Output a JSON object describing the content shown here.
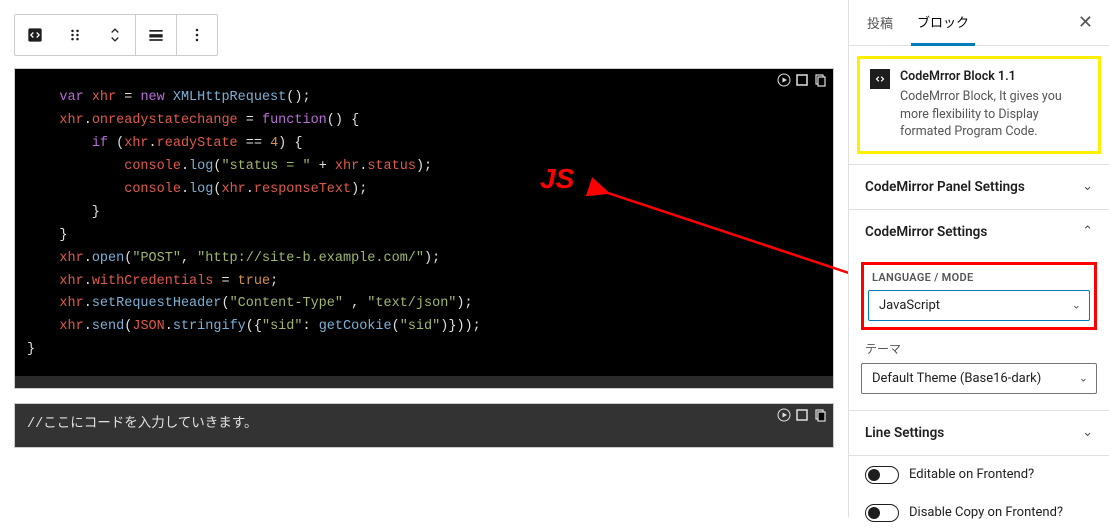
{
  "annotation": {
    "js_label": "JS"
  },
  "code1": {
    "lines": [
      [
        {
          "c": "kw",
          "t": "    var "
        },
        {
          "c": "var",
          "t": "xhr"
        },
        {
          "c": "op",
          "t": " = "
        },
        {
          "c": "kw",
          "t": "new "
        },
        {
          "c": "fn",
          "t": "XMLHttpRequest"
        },
        {
          "c": "op",
          "t": "();"
        }
      ],
      [
        {
          "c": "op",
          "t": "    "
        },
        {
          "c": "var",
          "t": "xhr"
        },
        {
          "c": "op",
          "t": "."
        },
        {
          "c": "var",
          "t": "onreadystatechange"
        },
        {
          "c": "op",
          "t": " = "
        },
        {
          "c": "kw",
          "t": "function"
        },
        {
          "c": "op",
          "t": "() {"
        }
      ],
      [
        {
          "c": "op",
          "t": "        "
        },
        {
          "c": "kw",
          "t": "if"
        },
        {
          "c": "op",
          "t": " ("
        },
        {
          "c": "var",
          "t": "xhr"
        },
        {
          "c": "op",
          "t": "."
        },
        {
          "c": "var",
          "t": "readyState"
        },
        {
          "c": "op",
          "t": " == "
        },
        {
          "c": "num",
          "t": "4"
        },
        {
          "c": "op",
          "t": ") {"
        }
      ],
      [
        {
          "c": "op",
          "t": "            "
        },
        {
          "c": "var",
          "t": "console"
        },
        {
          "c": "op",
          "t": "."
        },
        {
          "c": "fn",
          "t": "log"
        },
        {
          "c": "op",
          "t": "("
        },
        {
          "c": "str",
          "t": "\"status = \""
        },
        {
          "c": "op",
          "t": " + "
        },
        {
          "c": "var",
          "t": "xhr"
        },
        {
          "c": "op",
          "t": "."
        },
        {
          "c": "var",
          "t": "status"
        },
        {
          "c": "op",
          "t": ");"
        }
      ],
      [
        {
          "c": "op",
          "t": "            "
        },
        {
          "c": "var",
          "t": "console"
        },
        {
          "c": "op",
          "t": "."
        },
        {
          "c": "fn",
          "t": "log"
        },
        {
          "c": "op",
          "t": "("
        },
        {
          "c": "var",
          "t": "xhr"
        },
        {
          "c": "op",
          "t": "."
        },
        {
          "c": "var",
          "t": "responseText"
        },
        {
          "c": "op",
          "t": ");"
        }
      ],
      [
        {
          "c": "op",
          "t": "        }"
        }
      ],
      [
        {
          "c": "op",
          "t": "    }"
        }
      ],
      [
        {
          "c": "op",
          "t": "    "
        },
        {
          "c": "var",
          "t": "xhr"
        },
        {
          "c": "op",
          "t": "."
        },
        {
          "c": "fn",
          "t": "open"
        },
        {
          "c": "op",
          "t": "("
        },
        {
          "c": "str",
          "t": "\"POST\""
        },
        {
          "c": "op",
          "t": ", "
        },
        {
          "c": "str",
          "t": "\"http://site-b.example.com/\""
        },
        {
          "c": "op",
          "t": ");"
        }
      ],
      [
        {
          "c": "op",
          "t": "    "
        },
        {
          "c": "var",
          "t": "xhr"
        },
        {
          "c": "op",
          "t": "."
        },
        {
          "c": "var",
          "t": "withCredentials"
        },
        {
          "c": "op",
          "t": " = "
        },
        {
          "c": "bool",
          "t": "true"
        },
        {
          "c": "op",
          "t": ";"
        }
      ],
      [
        {
          "c": "op",
          "t": "    "
        },
        {
          "c": "var",
          "t": "xhr"
        },
        {
          "c": "op",
          "t": "."
        },
        {
          "c": "fn",
          "t": "setRequestHeader"
        },
        {
          "c": "op",
          "t": "("
        },
        {
          "c": "str",
          "t": "\"Content-Type\""
        },
        {
          "c": "op",
          "t": " , "
        },
        {
          "c": "str",
          "t": "\"text/json\""
        },
        {
          "c": "op",
          "t": ");"
        }
      ],
      [
        {
          "c": "op",
          "t": "    "
        },
        {
          "c": "var",
          "t": "xhr"
        },
        {
          "c": "op",
          "t": "."
        },
        {
          "c": "fn",
          "t": "send"
        },
        {
          "c": "op",
          "t": "("
        },
        {
          "c": "var",
          "t": "JSON"
        },
        {
          "c": "op",
          "t": "."
        },
        {
          "c": "fn",
          "t": "stringify"
        },
        {
          "c": "op",
          "t": "({"
        },
        {
          "c": "str",
          "t": "\"sid\""
        },
        {
          "c": "op",
          "t": ": "
        },
        {
          "c": "fn",
          "t": "getCookie"
        },
        {
          "c": "op",
          "t": "("
        },
        {
          "c": "str",
          "t": "\"sid\""
        },
        {
          "c": "op",
          "t": ")}));"
        }
      ],
      [
        {
          "c": "op",
          "t": "}"
        }
      ]
    ]
  },
  "code2": {
    "placeholder": "//ここにコードを入力していきます。"
  },
  "sidebar": {
    "tabs": {
      "post": "投稿",
      "block": "ブロック"
    },
    "info": {
      "title": "CodeMrror Block 1.1",
      "desc": "CodeMrror Block, It gives you more flexibility to Display formated Program Code."
    },
    "panels": {
      "panel_settings": "CodeMirror Panel Settings",
      "cm_settings": "CodeMirror Settings",
      "line_settings": "Line Settings"
    },
    "lang_mode": {
      "label": "LANGUAGE / MODE",
      "value": "JavaScript"
    },
    "theme": {
      "label": "テーマ",
      "value": "Default Theme (Base16-dark)"
    },
    "toggles": {
      "editable": "Editable on Frontend?",
      "disable_copy": "Disable Copy on Frontend?"
    }
  }
}
